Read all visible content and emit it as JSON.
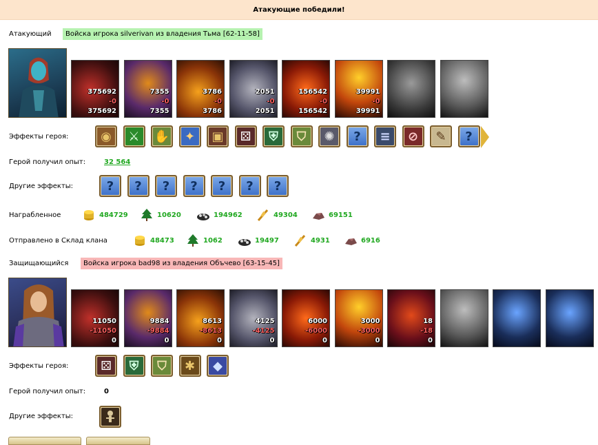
{
  "banner": {
    "title": "Атакующие победили!"
  },
  "attacker": {
    "role_label": "Атакующий",
    "army_label": "Войска игрока silverivan из владения Тьма [62-11-58]",
    "units": [
      {
        "name": "red-dragon-unit",
        "n1": "375692",
        "n2": "-0",
        "n3": "375692"
      },
      {
        "name": "lich-unit",
        "n1": "7355",
        "n2": "-0",
        "n3": "7355"
      },
      {
        "name": "fire-beast-unit",
        "n1": "3786",
        "n2": "-0",
        "n3": "3786"
      },
      {
        "name": "gray-dragon-unit",
        "n1": "2051",
        "n2": "-0",
        "n3": "2051"
      },
      {
        "name": "fire-elemental-unit",
        "n1": "156542",
        "n2": "-0",
        "n3": "156542"
      },
      {
        "name": "flame-warrior-unit",
        "n1": "39991",
        "n2": "-0",
        "n3": "39991"
      },
      {
        "name": "minotaur-gray-unit",
        "n1": "",
        "n2": "",
        "n3": ""
      },
      {
        "name": "reaper-gray-unit",
        "n1": "",
        "n2": "",
        "n3": ""
      }
    ],
    "effects_label": "Эффекты героя:",
    "xp_label": "Герой получил опыт:",
    "xp_value": "32 564",
    "other_label": "Другие эффекты:",
    "looted_label": "Награбленное",
    "looted": {
      "gold": "484729",
      "wood": "10620",
      "ore": "194962",
      "grain": "49304",
      "stone": "69151"
    },
    "clan_label": "Отправлено в Склад клана",
    "clan": {
      "gold": "48473",
      "wood": "1062",
      "ore": "19497",
      "grain": "4931",
      "stone": "6916"
    }
  },
  "defender": {
    "role_label": "Защищающийся",
    "army_label": "Войска игрока bad98 из владения Объчево [63-15-45]",
    "units": [
      {
        "name": "red-dragon-unit",
        "n1": "11050",
        "n2": "-11050",
        "n3": "0"
      },
      {
        "name": "lich-unit",
        "n1": "9884",
        "n2": "-9884",
        "n3": "0"
      },
      {
        "name": "fire-beast-unit",
        "n1": "8613",
        "n2": "-8613",
        "n3": "0"
      },
      {
        "name": "gray-dragon-unit",
        "n1": "4125",
        "n2": "-4125",
        "n3": "0"
      },
      {
        "name": "fire-elemental-unit",
        "n1": "6000",
        "n2": "-6000",
        "n3": "0"
      },
      {
        "name": "flame-warrior-unit",
        "n1": "3000",
        "n2": "-3000",
        "n3": "0"
      },
      {
        "name": "demon-lord-unit",
        "n1": "18",
        "n2": "-18",
        "n3": "0"
      },
      {
        "name": "reaper-gray-unit",
        "n1": "",
        "n2": "",
        "n3": ""
      },
      {
        "name": "crystal-tower-unit",
        "n1": "",
        "n2": "",
        "n3": ""
      },
      {
        "name": "crystal-tower-unit-2",
        "n1": "",
        "n2": "",
        "n3": ""
      }
    ],
    "effects_label": "Эффекты героя:",
    "xp_label": "Герой получил опыт:",
    "xp_value": "0",
    "other_label": "Другие эффекты:"
  },
  "unknown_glyph": "?",
  "colors": {
    "banner": "#fde5cc",
    "army_green": "#b6f2b0",
    "army_red": "#f8b7b7",
    "resource_text": "#21a821"
  }
}
